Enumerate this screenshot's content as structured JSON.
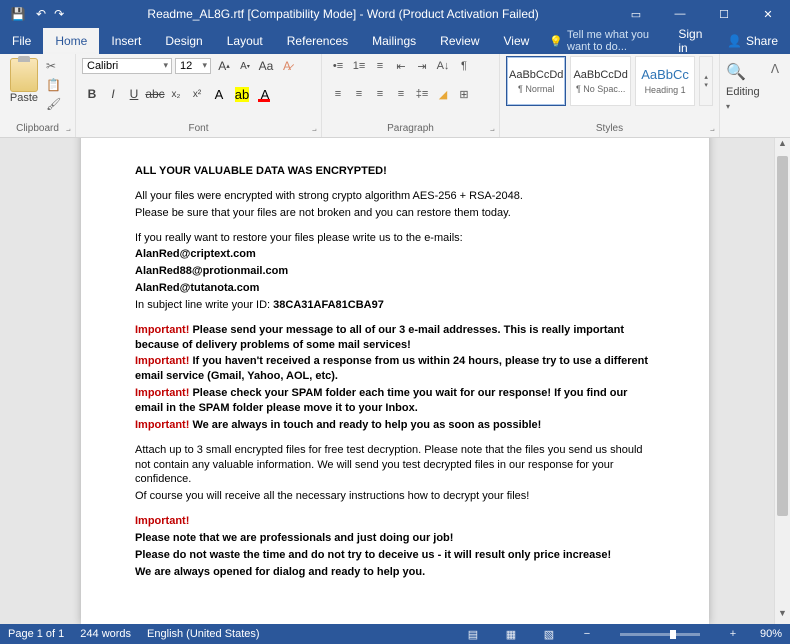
{
  "window": {
    "title": "Readme_AL8G.rtf [Compatibility Mode] - Word (Product Activation Failed)"
  },
  "menu": {
    "file": "File",
    "home": "Home",
    "insert": "Insert",
    "design": "Design",
    "layout": "Layout",
    "references": "References",
    "mailings": "Mailings",
    "review": "Review",
    "view": "View",
    "tell": "Tell me what you want to do...",
    "signin": "Sign in",
    "share": "Share"
  },
  "ribbon": {
    "clipboard": {
      "label": "Clipboard",
      "paste": "Paste"
    },
    "font": {
      "label": "Font",
      "name": "Calibri",
      "size": "12"
    },
    "paragraph": {
      "label": "Paragraph"
    },
    "styles": {
      "label": "Styles",
      "sample": "AaBbCcDd",
      "sample_h": "AaBbCc",
      "normal": "¶ Normal",
      "nospace": "¶ No Spac...",
      "heading1": "Heading 1"
    },
    "editing": {
      "label": "Editing",
      "text": "Editing"
    }
  },
  "doc": {
    "h": "ALL YOUR VALUABLE DATA WAS ENCRYPTED!",
    "p1": "All your files were encrypted with strong crypto algorithm AES-256 + RSA-2048.",
    "p2": "Please be sure that your files are not broken and you can restore them today.",
    "p3": "If you really want to restore your files please write us to the e-mails:",
    "e1": "AlanRed@criptext.com",
    "e2": "AlanRed88@protionmail.com",
    "e3": "AlanRed@tutanota.com",
    "idline_a": "In subject line write your ID: ",
    "idline_b": "38CA31AFA81CBA97",
    "imp": "Important!",
    "i1": " Please send your message to all of our 3 e-mail addresses. This is really important because of delivery problems of some mail services!",
    "i2": " If you haven't received a response from us within 24 hours, please try to use a different email service (Gmail, Yahoo, AOL, etc).",
    "i3": " Please check your SPAM folder each time you wait for our response! If you find our email in the SPAM folder please move it to your Inbox.",
    "i4": " We are always in touch and ready to help you as soon as possible!",
    "a1": "Attach up to 3 small encrypted files for free test decryption. Please note that the files you send us should not contain any valuable information. We will send you test decrypted files in our response for your confidence.",
    "a2": "Of course you will receive all the necessary instructions how to decrypt your files!",
    "f1": "Please note that we are professionals and just doing our job!",
    "f2": "Please do not waste the time and do not try to deceive us - it will result only price increase!",
    "f3": "We are always opened for dialog and ready to help you."
  },
  "status": {
    "page": "Page 1 of 1",
    "words": "244 words",
    "lang": "English (United States)",
    "zoom": "90%"
  }
}
